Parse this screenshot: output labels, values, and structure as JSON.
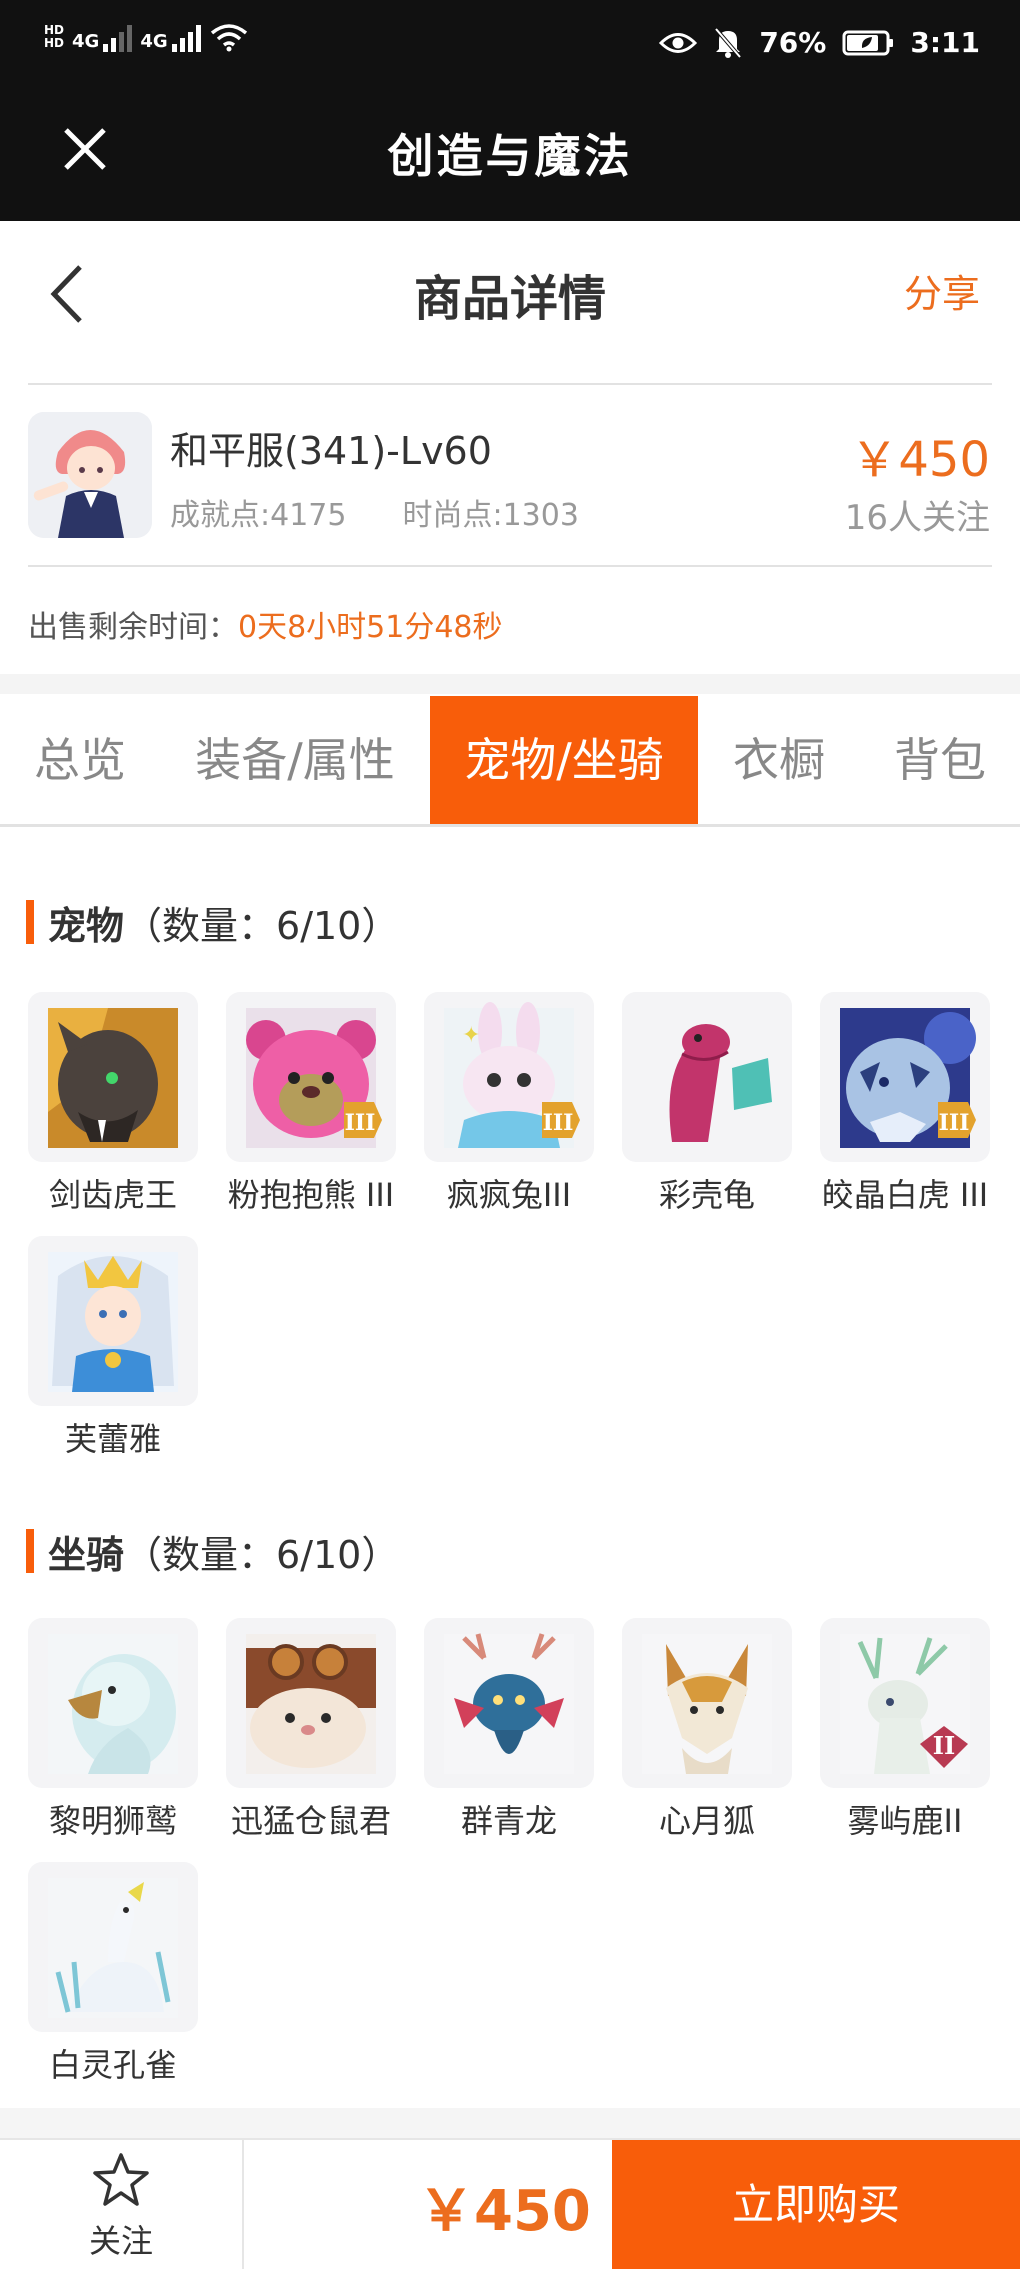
{
  "status_bar": {
    "hd_top": "HD",
    "hd_bottom": "HD",
    "net1": "4G",
    "net2": "4G",
    "battery_percent": "76%",
    "time": "3:11"
  },
  "titlebar": {
    "title": "创造与魔法"
  },
  "page": {
    "title": "商品详情",
    "share": "分享"
  },
  "product": {
    "name": "和平服(341)-Lv60",
    "achievement": "成就点:4175",
    "fashion": "时尚点:1303",
    "price": "￥450",
    "followers": "16人关注"
  },
  "timer": {
    "label": "出售剩余时间：",
    "value": "0天8小时51分48秒"
  },
  "tabs": [
    {
      "label": "总览"
    },
    {
      "label": "装备/属性"
    },
    {
      "label": "宠物/坐骑"
    },
    {
      "label": "衣橱"
    },
    {
      "label": "背包"
    }
  ],
  "pets": {
    "title": "宠物",
    "count": "（数量：6/10）",
    "items": [
      {
        "name": "剑齿虎王",
        "icon": "sabertooth-tiger-icon"
      },
      {
        "name": "粉抱抱熊 III",
        "icon": "pink-bear-icon"
      },
      {
        "name": "疯疯兔III",
        "icon": "crazy-rabbit-icon"
      },
      {
        "name": "彩壳龟",
        "icon": "shell-turtle-icon"
      },
      {
        "name": "皎晶白虎 III",
        "icon": "crystal-tiger-icon"
      },
      {
        "name": "芙蕾雅",
        "icon": "freya-icon"
      }
    ]
  },
  "mounts": {
    "title": "坐骑",
    "count": "（数量：6/10）",
    "items": [
      {
        "name": "黎明狮鹫",
        "icon": "griffin-icon"
      },
      {
        "name": "迅猛仓鼠君",
        "icon": "hamster-icon"
      },
      {
        "name": "群青龙",
        "icon": "blue-dragon-icon"
      },
      {
        "name": "心月狐",
        "icon": "moon-fox-icon"
      },
      {
        "name": "雾屿鹿II",
        "icon": "mist-deer-icon"
      },
      {
        "name": "白灵孔雀",
        "icon": "white-peacock-icon"
      }
    ]
  },
  "bottom_bar": {
    "follow": "关注",
    "price": "￥450",
    "buy": "立即购买"
  },
  "colors": {
    "accent": "#f85d0a",
    "price": "#ec6d1e",
    "dark_bar": "#111111"
  }
}
